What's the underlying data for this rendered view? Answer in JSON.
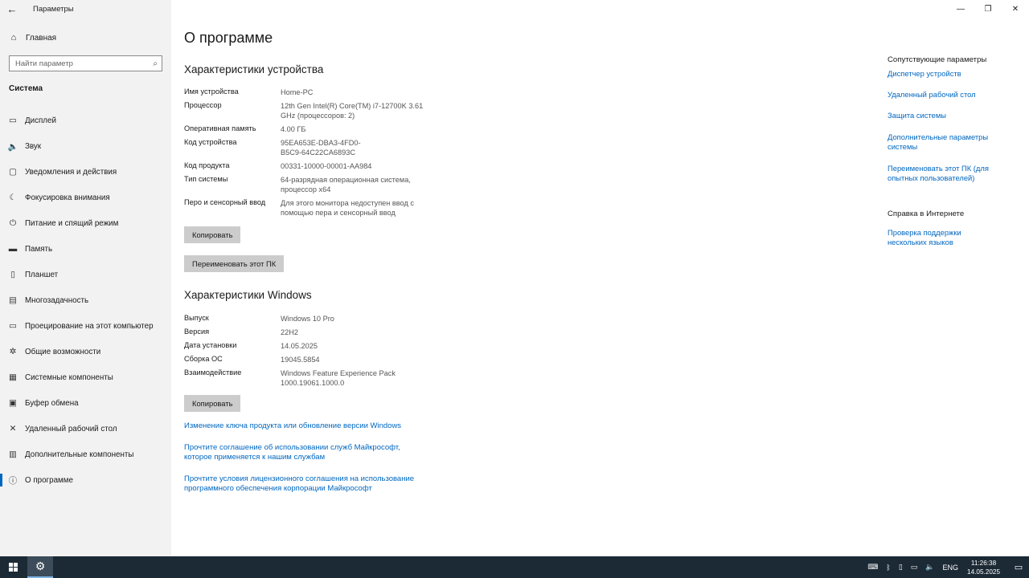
{
  "window": {
    "title": "Параметры",
    "back_icon": "←",
    "minimize": "—",
    "restore": "❐",
    "close": "✕"
  },
  "sidebar": {
    "home": "Главная",
    "search_placeholder": "Найти параметр",
    "section": "Система",
    "items": [
      {
        "icon": "▭",
        "label": "Дисплей"
      },
      {
        "icon": "🔈",
        "label": "Звук"
      },
      {
        "icon": "▢",
        "label": "Уведомления и действия"
      },
      {
        "icon": "☾",
        "label": "Фокусировка внимания"
      },
      {
        "icon": "⏻",
        "label": "Питание и спящий режим"
      },
      {
        "icon": "▬",
        "label": "Память"
      },
      {
        "icon": "▯",
        "label": "Планшет"
      },
      {
        "icon": "▤",
        "label": "Многозадачность"
      },
      {
        "icon": "▭",
        "label": "Проецирование на этот компьютер"
      },
      {
        "icon": "✲",
        "label": "Общие возможности"
      },
      {
        "icon": "▦",
        "label": "Системные компоненты"
      },
      {
        "icon": "▣",
        "label": "Буфер обмена"
      },
      {
        "icon": "✕",
        "label": "Удаленный рабочий стол"
      },
      {
        "icon": "▥",
        "label": "Дополнительные компоненты"
      },
      {
        "icon": "ⓘ",
        "label": "О программе"
      }
    ]
  },
  "main": {
    "title": "О программе",
    "device_header": "Характеристики устройства",
    "device_specs": [
      {
        "k": "Имя устройства",
        "v": "Home-PC"
      },
      {
        "k": "Процессор",
        "v": "12th Gen Intel(R) Core(TM) i7-12700K   3.61 GHz (процессоров: 2)"
      },
      {
        "k": "Оперативная память",
        "v": "4.00 ГБ"
      },
      {
        "k": "Код устройства",
        "v": "95EA653E-DBA3-4FD0-B5C9-64C22CA6893C"
      },
      {
        "k": "Код продукта",
        "v": "00331-10000-00001-AA984"
      },
      {
        "k": "Тип системы",
        "v": "64-разрядная операционная система, процессор x64"
      },
      {
        "k": "Перо и сенсорный ввод",
        "v": "Для этого монитора недоступен ввод с помощью пера и сенсорный ввод"
      }
    ],
    "copy_btn_1": "Копировать",
    "rename_btn": "Переименовать этот ПК",
    "windows_header": "Характеристики Windows",
    "windows_specs": [
      {
        "k": "Выпуск",
        "v": "Windows 10 Pro"
      },
      {
        "k": "Версия",
        "v": "22H2"
      },
      {
        "k": "Дата установки",
        "v": "14.05.2025"
      },
      {
        "k": "Сборка ОС",
        "v": "19045.5854"
      },
      {
        "k": "Взаимодействие",
        "v": "Windows Feature Experience Pack 1000.19061.1000.0"
      }
    ],
    "copy_btn_2": "Копировать",
    "links": [
      "Изменение ключа продукта или обновление версии Windows",
      "Прочтите соглашение об использовании служб Майкрософт, которое применяется к нашим службам",
      "Прочтите условия лицензионного соглашения на использование программного обеспечения корпорации Майкрософт"
    ]
  },
  "right_panel": {
    "related_header": "Сопутствующие параметры",
    "related_links": [
      "Диспетчер устройств",
      "Удаленный рабочий стол",
      "Защита системы",
      "Дополнительные параметры системы",
      "Переименовать этот ПК (для опытных пользователей)"
    ],
    "help_header": "Справка в Интернете",
    "help_links": [
      "Проверка поддержки нескольких языков"
    ]
  },
  "taskbar": {
    "lang": "ENG",
    "time": "11:26:38",
    "date": "14.05.2025"
  }
}
